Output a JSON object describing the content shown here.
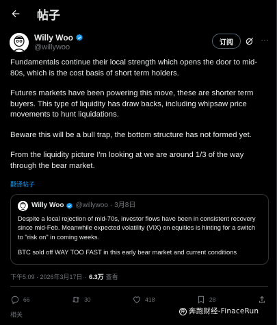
{
  "header": {
    "title": "帖子"
  },
  "author": {
    "name": "Willy Woo",
    "handle": "@willywoo"
  },
  "post_actions": {
    "subscribe_label": "订阅"
  },
  "post": {
    "paragraphs": [
      "Fundamentals continue their local strength which opens the door to mid-80s, which is the cost basis of short term holders.",
      "Futures markets have been powering this move, these are shorter term buyers. This type of liquidity has draw backs, including whipsaw price movements to hunt liquidations.",
      "Beware this will be a bull trap, the bottom structure has not formed yet.",
      "From the liquidity picture I'm looking at we are around 1/3 of the way through the bear market."
    ],
    "translate_label": "翻译帖子"
  },
  "quote": {
    "name": "Willy Woo",
    "handle": "@willywoo",
    "dot": "·",
    "date": "3月8日",
    "paragraphs": [
      "Despite a local rejection of mid-70s, investor flows have been in consistent recovery since mid-Feb. Meanwhile expected volatility (VIX) on equities is hinting for a switch to \"risk on\" in coming weeks.",
      "BTC sold off WAY TOO FAST in this early bear market and current conditions"
    ]
  },
  "meta": {
    "timestamp": "下午5:09 · 2026年3月17日 ·",
    "views": "6.3万",
    "views_label": "查看"
  },
  "stats": {
    "replies": "66",
    "reposts": "30",
    "likes": "418",
    "bookmarks": "28"
  },
  "footer": {
    "related_label": "相关"
  },
  "watermark": {
    "text": "奔跑财经-FinaceRun"
  },
  "colors": {
    "accent": "#1d9bf0",
    "verified": "#1d9bf0",
    "background": "#000000",
    "border": "#2f3336",
    "secondary_text": "#71767b"
  }
}
